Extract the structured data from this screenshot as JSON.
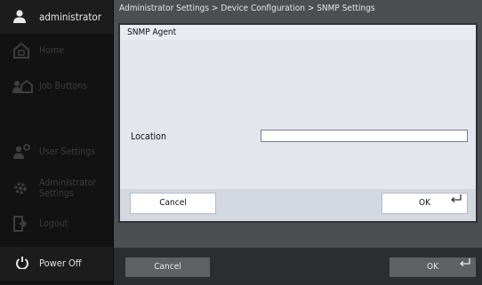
{
  "sidebar": {
    "user": "administrator",
    "items": [
      {
        "label": "Home"
      },
      {
        "label": "Job Buttons"
      },
      {
        "label": "User Settings"
      },
      {
        "label": "Administrator Settings"
      },
      {
        "label": "Logout"
      }
    ],
    "power": "Power Off"
  },
  "breadcrumb": "Administrator Settings > Device Configuration > SNMP Settings",
  "dialog": {
    "title": "SNMP Agent",
    "field_label": "Location",
    "field_value": "",
    "cancel": "Cancel",
    "ok": "OK"
  },
  "footer": {
    "cancel": "Cancel",
    "ok": "OK"
  },
  "icons": {
    "user": "user-icon",
    "home": "home-icon",
    "job": "job-buttons-icon",
    "user_settings": "user-settings-icon",
    "admin": "gear-icon",
    "logout": "logout-icon",
    "power": "power-icon",
    "enter": "enter-icon"
  }
}
